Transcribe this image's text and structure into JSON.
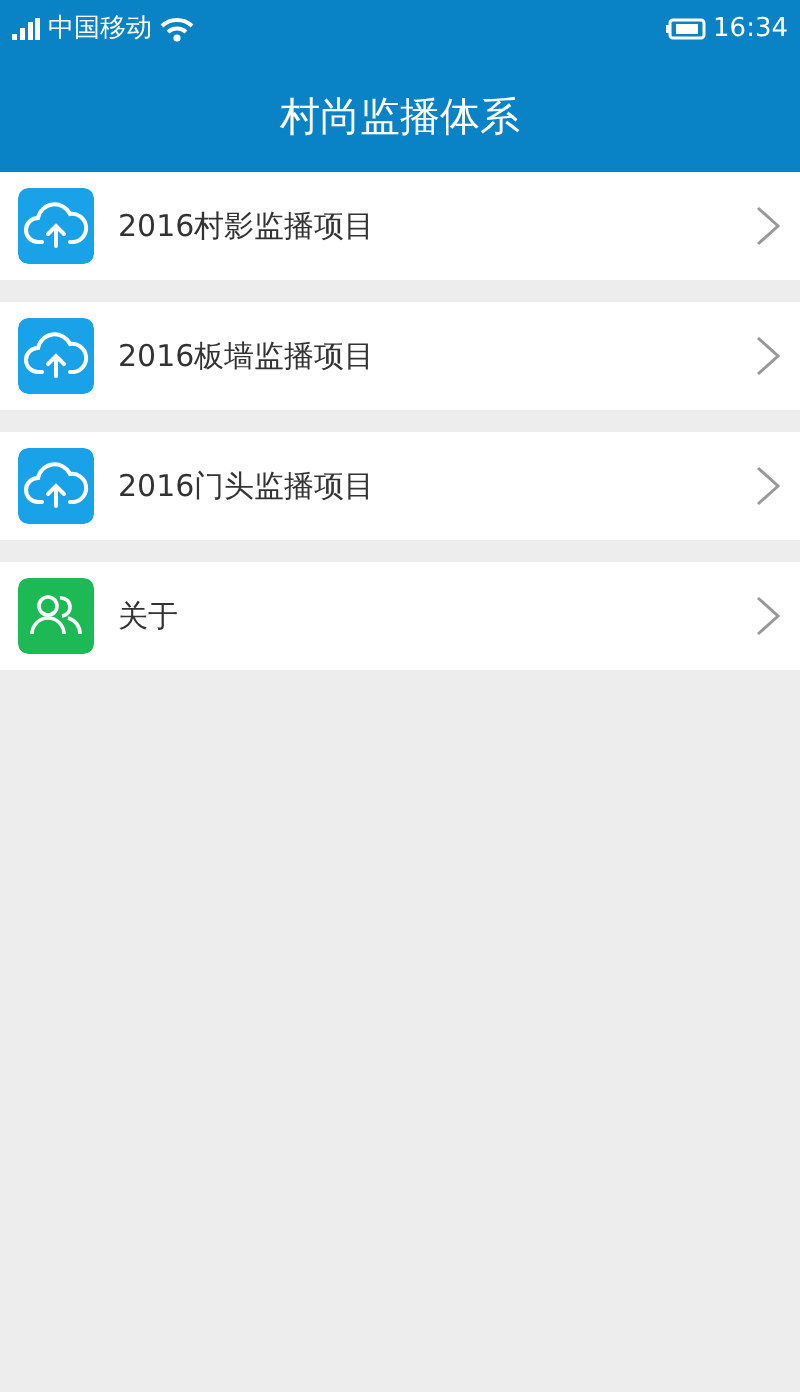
{
  "status_bar": {
    "carrier": "中国移动",
    "time": "16:34"
  },
  "header": {
    "title": "村尚监播体系"
  },
  "menu": [
    {
      "label": "2016村影监播项目",
      "kind": "upload",
      "color": "#1aa2e8"
    },
    {
      "label": "2016板墙监播项目",
      "kind": "upload",
      "color": "#1aa2e8"
    },
    {
      "label": "2016门头监播项目",
      "kind": "upload",
      "color": "#1aa2e8"
    },
    {
      "label": "关于",
      "kind": "people",
      "color": "#1db954"
    }
  ]
}
